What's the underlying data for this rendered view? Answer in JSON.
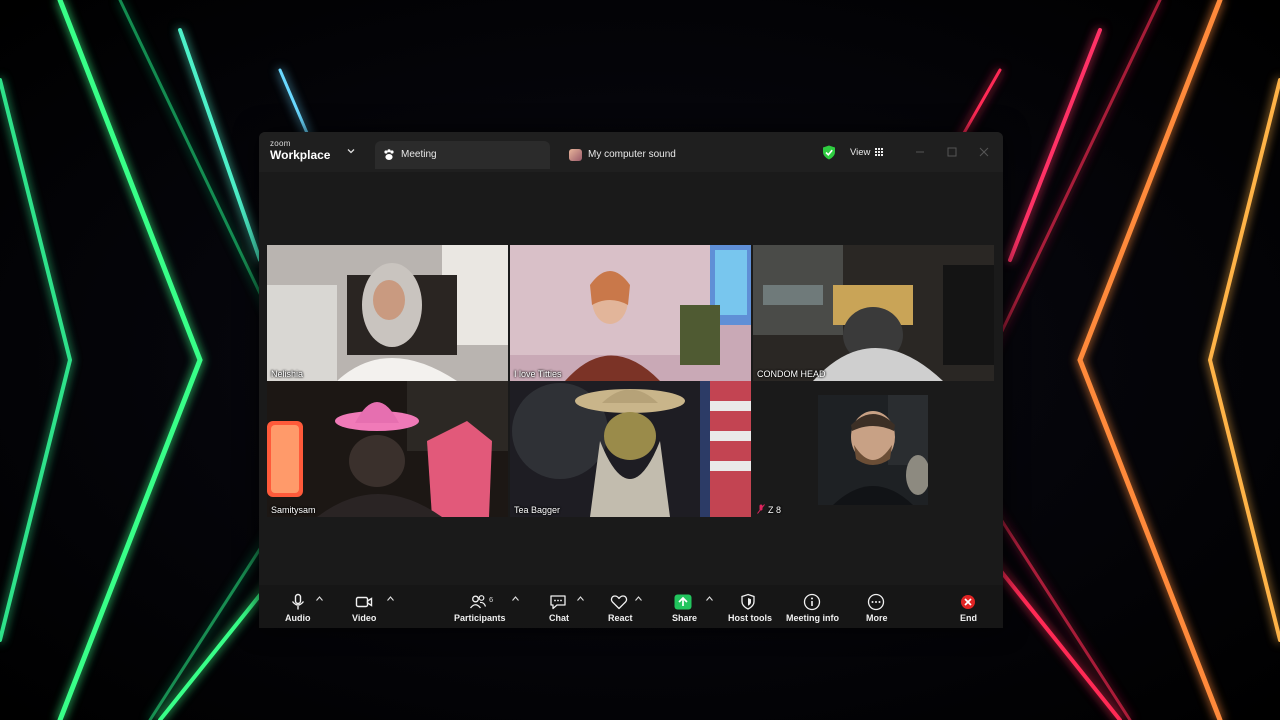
{
  "window": {
    "logo_small": "zoom",
    "logo_big": "Workplace",
    "tabs": [
      {
        "label": "Meeting",
        "active": true,
        "icon": "paw-icon"
      },
      {
        "label": "My computer sound",
        "active": false,
        "icon": "sound-share-icon"
      }
    ],
    "view_label": "View",
    "security_color": "#2ecc40"
  },
  "participants": [
    {
      "name": "Nelishia",
      "speaking": false
    },
    {
      "name": "I love Titties",
      "speaking": false
    },
    {
      "name": "CONDOM HEAD",
      "speaking": false
    },
    {
      "name": "Samitysam",
      "speaking": true
    },
    {
      "name": "Tea Bagger",
      "speaking": false
    },
    {
      "name": "Z 8",
      "speaking": false,
      "muted": true
    }
  ],
  "toolbar": {
    "audio": "Audio",
    "video": "Video",
    "participants": "Participants",
    "participants_count": "6",
    "chat": "Chat",
    "react": "React",
    "share": "Share",
    "host_tools": "Host tools",
    "meeting_info": "Meeting info",
    "more": "More",
    "end": "End"
  },
  "colors": {
    "speaking_outline": "#33dd77",
    "share_green": "#22c55e",
    "end_red": "#e02424",
    "neon_green": "#39ff88",
    "neon_red": "#ff2a55",
    "neon_orange": "#ffa040"
  }
}
